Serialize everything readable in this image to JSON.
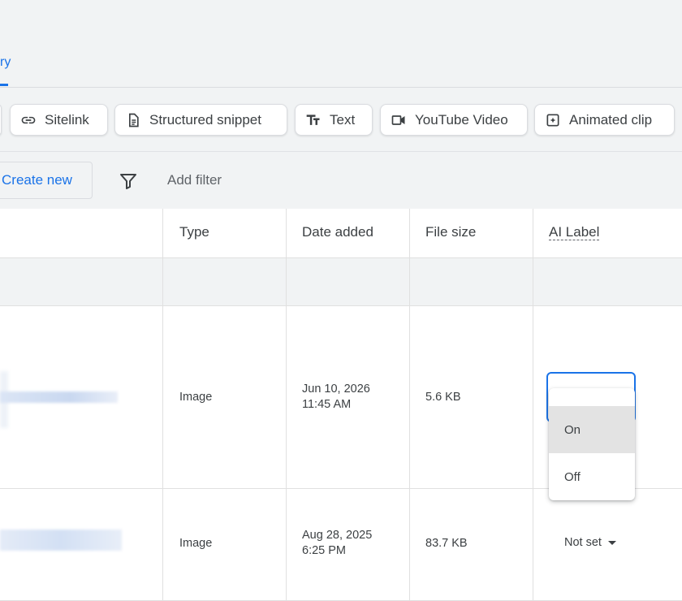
{
  "tabs": {
    "active_label_fragment": "ry"
  },
  "asset_chips": [
    {
      "label": "Sitelink",
      "icon": "link-icon"
    },
    {
      "label": "Structured snippet",
      "icon": "document-icon"
    },
    {
      "label": "Text",
      "icon": "text-format-icon"
    },
    {
      "label": "YouTube Video",
      "icon": "video-camera-icon"
    },
    {
      "label": "Animated clip",
      "icon": "animated-clip-icon"
    }
  ],
  "toolbar": {
    "create_label": "Create new",
    "add_filter_label": "Add filter"
  },
  "table": {
    "columns": [
      "Type",
      "Date added",
      "File size",
      "AI Label"
    ],
    "rows": [
      {
        "type": "Image",
        "date_line1": "Jun 10, 2026",
        "date_line2": "11:45 AM",
        "file_size": "5.6 KB",
        "ai_label": ""
      },
      {
        "type": "Image",
        "date_line1": "Aug 28, 2025",
        "date_line2": "6:25 PM",
        "file_size": "83.7 KB",
        "ai_label": "Not set"
      }
    ]
  },
  "ai_label_menu": {
    "options": [
      "On",
      "Off"
    ],
    "highlighted": "On"
  },
  "colors": {
    "accent": "#1a73e8",
    "page_bg": "#f1f3f4",
    "border": "#dadce0"
  }
}
